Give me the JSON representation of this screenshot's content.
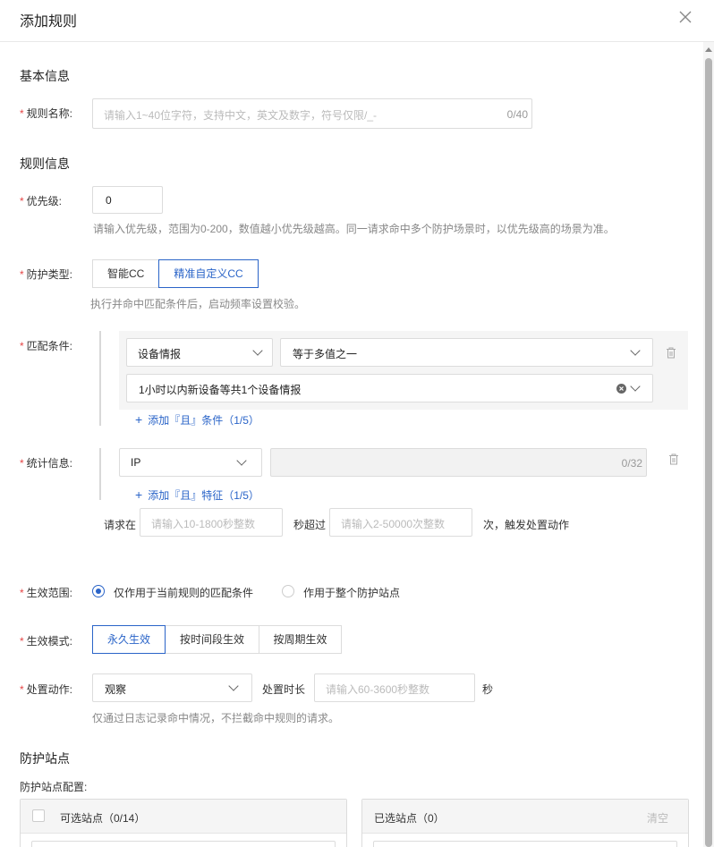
{
  "dialog": {
    "title": "添加规则"
  },
  "basic": {
    "section_title": "基本信息",
    "name_label": "规则名称:",
    "name_placeholder": "请输入1~40位字符，支持中文，英文及数字，符号仅限/_-",
    "name_count": "0/40"
  },
  "rule": {
    "section_title": "规则信息",
    "priority_label": "优先级:",
    "priority_value": "0",
    "priority_hint": "请输入优先级，范围为0-200，数值越小优先级越高。同一请求命中多个防护场景时，以优先级高的场景为准。",
    "type_label": "防护类型:",
    "type_options": [
      "智能CC",
      "精准自定义CC"
    ],
    "type_selected": "精准自定义CC",
    "type_hint": "执行并命中匹配条件后，启动频率设置校验。",
    "match_label": "匹配条件:",
    "match_field": "设备情报",
    "match_operator": "等于多值之一",
    "match_value": "1小时以内新设备等共1个设备情报",
    "add_condition": "添加『且』条件（1/5）",
    "stat_label": "统计信息:",
    "stat_field": "IP",
    "stat_count": "0/32",
    "add_feature": "添加『且』特征（1/5）",
    "freq_prefix": "请求在",
    "freq_seconds_placeholder": "请输入10-1800秒整数",
    "freq_middle": "秒超过",
    "freq_times_placeholder": "请输入2-50000次整数",
    "freq_suffix": "次，触发处置动作",
    "scope_label": "生效范围:",
    "scope_options": [
      "仅作用于当前规则的匹配条件",
      "作用于整个防护站点"
    ],
    "mode_label": "生效模式:",
    "mode_options": [
      "永久生效",
      "按时间段生效",
      "按周期生效"
    ],
    "action_label": "处置动作:",
    "action_value": "观察",
    "duration_label": "处置时长",
    "duration_placeholder": "请输入60-3600秒整数",
    "duration_unit": "秒",
    "action_hint": "仅通过日志记录命中情况，不拦截命中规则的请求。"
  },
  "sites": {
    "section_title": "防护站点",
    "config_label": "防护站点配置:",
    "available_title": "可选站点（0/14）",
    "selected_title": "已选站点（0）",
    "clear_label": "清空"
  }
}
